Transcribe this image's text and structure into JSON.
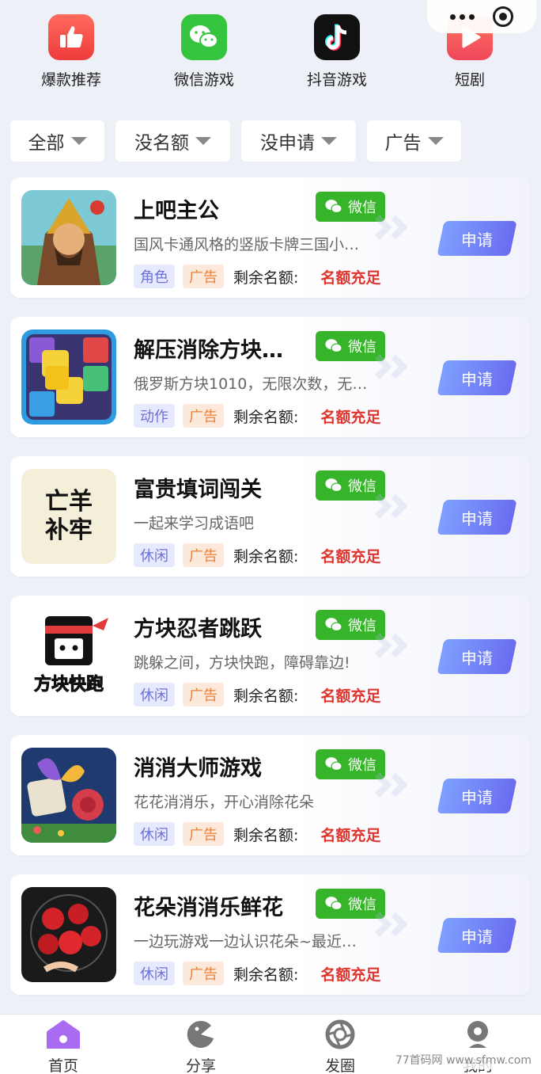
{
  "categories": [
    {
      "label": "爆款推荐",
      "icon": "thumbs-up-icon",
      "color": "#f4524a"
    },
    {
      "label": "微信游戏",
      "icon": "wechat-icon",
      "color": "#2cbd3a"
    },
    {
      "label": "抖音游戏",
      "icon": "douyin-icon",
      "color": "#111111"
    },
    {
      "label": "短剧",
      "icon": "play-icon",
      "color": "#f45a4d"
    }
  ],
  "filters": [
    {
      "label": "全部"
    },
    {
      "label": "没名额"
    },
    {
      "label": "没申请"
    },
    {
      "label": "广告"
    }
  ],
  "common": {
    "platform_label": "微信",
    "ad_tag": "广告",
    "remaining_label": "剩余名额:",
    "remaining_value": "名额充足",
    "apply_label": "申请"
  },
  "games": [
    {
      "title": "上吧主公",
      "desc": "国风卡通风格的竖版卡牌三国小…",
      "genre": "角色"
    },
    {
      "title": "解压消除方块…",
      "desc": "俄罗斯方块1010，无限次数，无…",
      "genre": "动作"
    },
    {
      "title": "富贵填词闯关",
      "desc": "一起来学习成语吧",
      "genre": "休闲",
      "thumb_text": [
        "亡羊",
        "补牢"
      ]
    },
    {
      "title": "方块忍者跳跃",
      "desc": "跳躲之间，方块快跑，障碍靠边!",
      "genre": "休闲",
      "thumb_text": [
        "方块快跑"
      ]
    },
    {
      "title": "消消大师游戏",
      "desc": "花花消消乐，开心消除花朵",
      "genre": "休闲"
    },
    {
      "title": "花朵消消乐鲜花",
      "desc": "一边玩游戏一边认识花朵~最近…",
      "genre": "休闲"
    }
  ],
  "nav": [
    {
      "label": "首页",
      "icon": "home-icon",
      "active": true
    },
    {
      "label": "分享",
      "icon": "share-icon"
    },
    {
      "label": "发圈",
      "icon": "aperture-icon"
    },
    {
      "label": "我的",
      "icon": "profile-icon"
    }
  ],
  "watermark": "77首码网 www.sfmw.com"
}
